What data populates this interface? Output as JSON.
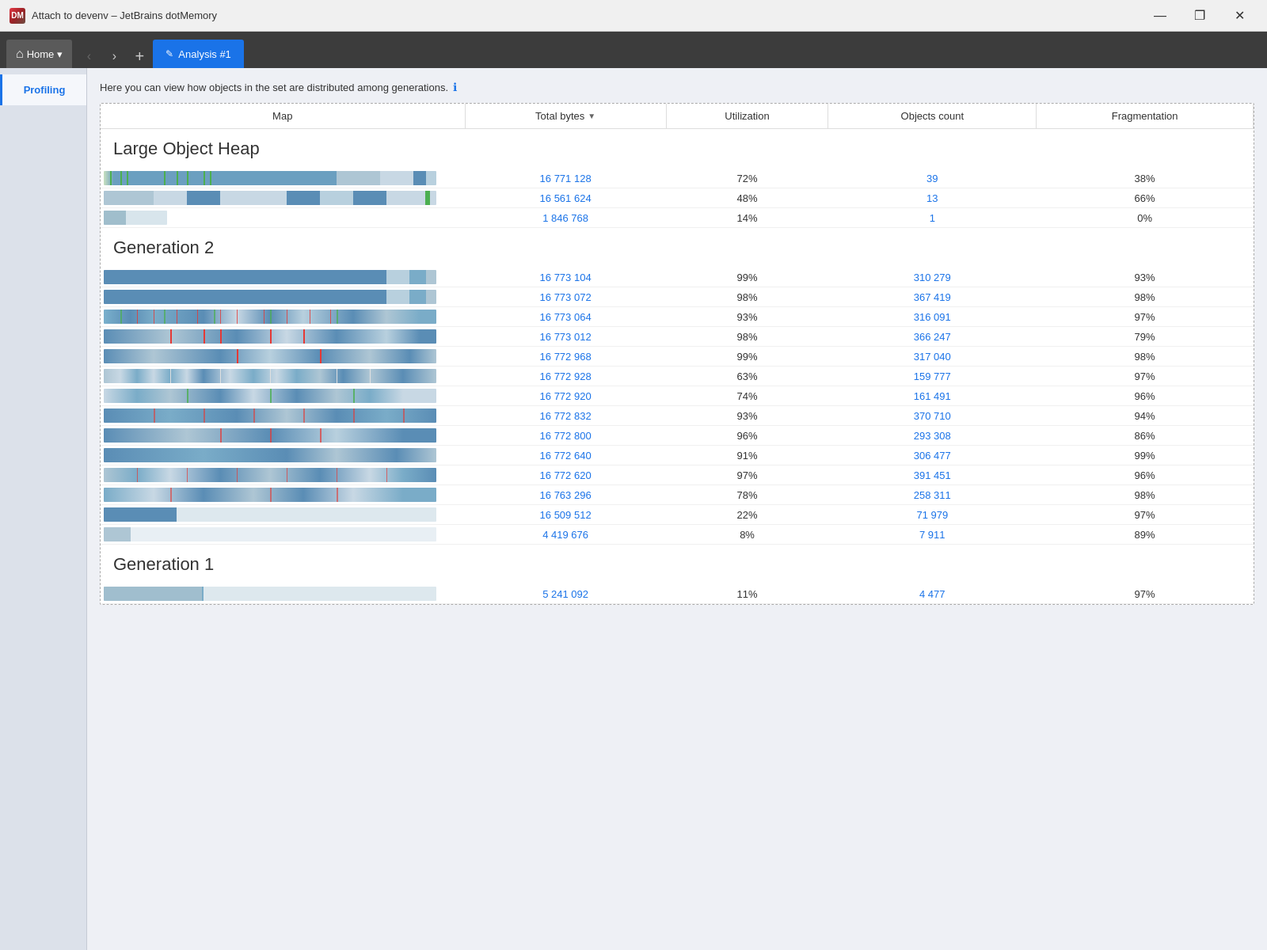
{
  "titleBar": {
    "icon": "DM",
    "title": "Attach to devenv – JetBrains dotMemory",
    "controls": [
      "—",
      "❐",
      "✕"
    ]
  },
  "tabBar": {
    "homeLabel": "Home",
    "dropdownArrow": "▾",
    "navBack": "‹",
    "navForward": "›",
    "addTab": "+",
    "analysisTab": "Analysis #1"
  },
  "sidebar": {
    "items": [
      {
        "label": "Profiling",
        "active": true
      }
    ]
  },
  "infoBar": {
    "text": "Here you can view how objects in the set are distributed among generations.",
    "infoIcon": "ℹ"
  },
  "table": {
    "columns": {
      "map": "Map",
      "totalBytes": "Total bytes",
      "utilization": "Utilization",
      "objectsCount": "Objects count",
      "fragmentation": "Fragmentation"
    },
    "sections": [
      {
        "name": "Large Object Heap",
        "rows": [
          {
            "totalBytes": "16 771 128",
            "utilization": "72%",
            "objectsCount": "39",
            "fragmentation": "38%",
            "barType": "loh1"
          },
          {
            "totalBytes": "16 561 624",
            "utilization": "48%",
            "objectsCount": "13",
            "fragmentation": "66%",
            "barType": "loh2"
          },
          {
            "totalBytes": "1 846 768",
            "utilization": "14%",
            "objectsCount": "1",
            "fragmentation": "0%",
            "barType": "loh3"
          }
        ]
      },
      {
        "name": "Generation 2",
        "rows": [
          {
            "totalBytes": "16 773 104",
            "utilization": "99%",
            "objectsCount": "310 279",
            "fragmentation": "93%",
            "barType": "gen2_full"
          },
          {
            "totalBytes": "16 773 072",
            "utilization": "98%",
            "objectsCount": "367 419",
            "fragmentation": "98%",
            "barType": "gen2_full"
          },
          {
            "totalBytes": "16 773 064",
            "utilization": "93%",
            "objectsCount": "316 091",
            "fragmentation": "97%",
            "barType": "gen2_ticks_red"
          },
          {
            "totalBytes": "16 773 012",
            "utilization": "98%",
            "objectsCount": "366 247",
            "fragmentation": "79%",
            "barType": "gen2_sparse_red"
          },
          {
            "totalBytes": "16 772 968",
            "utilization": "99%",
            "objectsCount": "317 040",
            "fragmentation": "98%",
            "barType": "gen2_sparse"
          },
          {
            "totalBytes": "16 772 928",
            "utilization": "63%",
            "objectsCount": "159 777",
            "fragmentation": "97%",
            "barType": "gen2_mixed"
          },
          {
            "totalBytes": "16 772 920",
            "utilization": "74%",
            "objectsCount": "161 491",
            "fragmentation": "96%",
            "barType": "gen2_sparse_green"
          },
          {
            "totalBytes": "16 772 832",
            "utilization": "93%",
            "objectsCount": "370 710",
            "fragmentation": "94%",
            "barType": "gen2_heavy"
          },
          {
            "totalBytes": "16 772 800",
            "utilization": "96%",
            "objectsCount": "293 308",
            "fragmentation": "86%",
            "barType": "gen2_med"
          },
          {
            "totalBytes": "16 772 640",
            "utilization": "91%",
            "objectsCount": "306 477",
            "fragmentation": "99%",
            "barType": "gen2_full2"
          },
          {
            "totalBytes": "16 772 620",
            "utilization": "97%",
            "objectsCount": "391 451",
            "fragmentation": "96%",
            "barType": "gen2_red2"
          },
          {
            "totalBytes": "16 763 296",
            "utilization": "78%",
            "objectsCount": "258 311",
            "fragmentation": "98%",
            "barType": "gen2_mixed2"
          },
          {
            "totalBytes": "16 509 512",
            "utilization": "22%",
            "objectsCount": "71 979",
            "fragmentation": "97%",
            "barType": "gen2_light"
          },
          {
            "totalBytes": "4 419 676",
            "utilization": "8%",
            "objectsCount": "7 911",
            "fragmentation": "89%",
            "barType": "gen2_vlight"
          }
        ]
      },
      {
        "name": "Generation 1",
        "rows": [
          {
            "totalBytes": "5 241 092",
            "utilization": "11%",
            "objectsCount": "4 477",
            "fragmentation": "97%",
            "barType": "gen1"
          }
        ]
      }
    ]
  }
}
